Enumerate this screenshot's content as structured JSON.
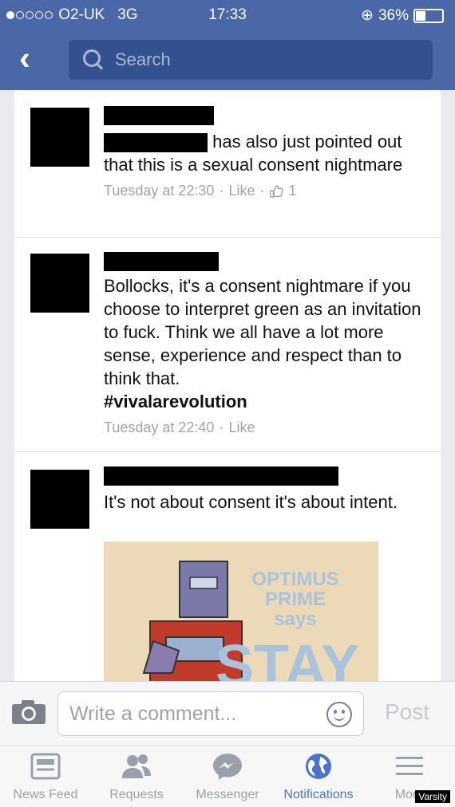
{
  "status_bar": {
    "carrier": "O2-UK",
    "network": "3G",
    "time": "17:33",
    "battery": "36%"
  },
  "search": {
    "placeholder": "Search"
  },
  "comments": [
    {
      "text": "has also just pointed out that this is a sexual consent nightmare",
      "time": "Tuesday at 22:30",
      "like": "Like",
      "likes": "1"
    },
    {
      "text": "Bollocks, it's a consent nightmare if you choose to interpret green as an invitation to fuck. Think we all have a lot more sense, experience and respect than to think that.",
      "hashtag": "#vivalarevolution",
      "time": "Tuesday at 22:40",
      "like": "Like"
    },
    {
      "text": "It's not about consent it's about intent.",
      "image_caption": "OPTIMUS PRIME says STAY"
    }
  ],
  "composer": {
    "placeholder": "Write a comment...",
    "post": "Post"
  },
  "tabs": [
    {
      "label": "News Feed",
      "icon": "news-feed-icon"
    },
    {
      "label": "Requests",
      "icon": "requests-icon"
    },
    {
      "label": "Messenger",
      "icon": "messenger-icon"
    },
    {
      "label": "Notifications",
      "icon": "globe-icon"
    },
    {
      "label": "More",
      "icon": "menu-icon"
    }
  ],
  "watermark": "Varsity"
}
